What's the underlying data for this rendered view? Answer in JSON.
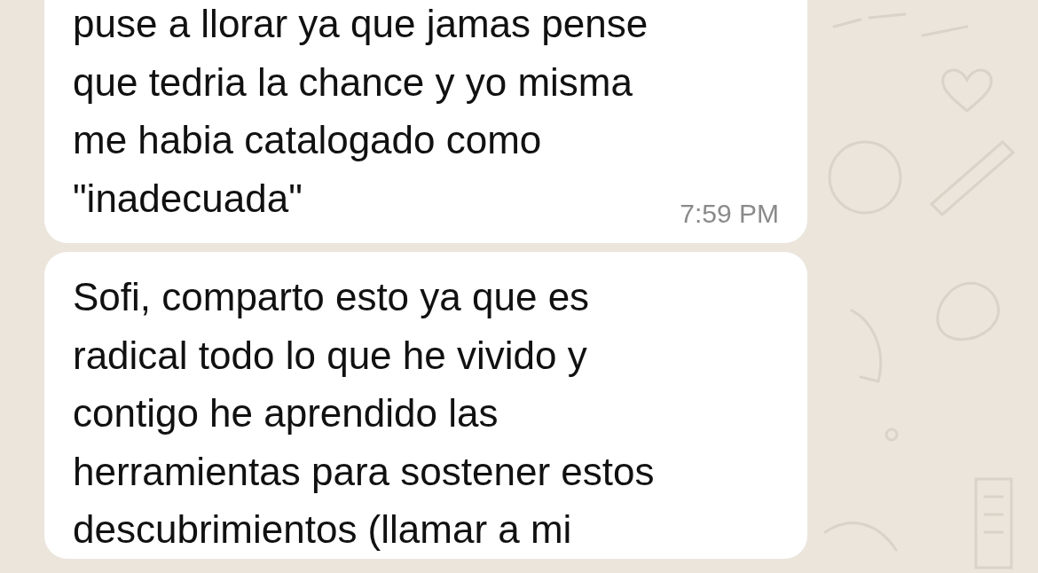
{
  "messages": [
    {
      "lines": [
        "puse a llorar ya que jamas pense",
        "que tedria la chance y yo misma",
        "me habia catalogado como",
        "\"inadecuada\""
      ],
      "time": "7:59 PM"
    },
    {
      "lines": [
        "Sofi, comparto esto ya que es",
        "radical todo lo que he vivido y",
        "contigo he aprendido las",
        "herramientas para sostener estos",
        "descubrimientos (llamar a mi"
      ]
    }
  ]
}
